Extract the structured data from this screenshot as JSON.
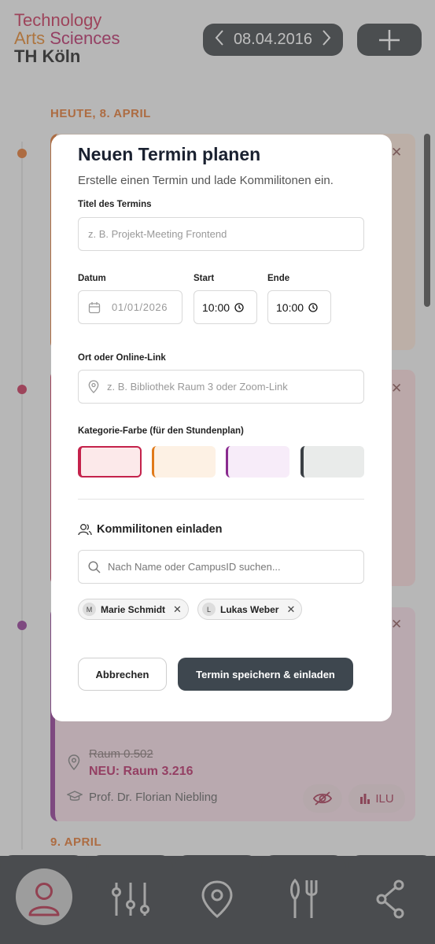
{
  "app": {
    "logo": {
      "line1": "Technology",
      "line2a": "Arts ",
      "line2b": "Sciences",
      "line3": "TH Köln"
    },
    "date": "08.04.2016",
    "day_heading_1": "HEUTE, 8. APRIL",
    "day_heading_2": "9. APRIL",
    "card3": {
      "old_room": "Raum 0.502",
      "new_room": "NEU: Raum 3.216",
      "lecturer": "Prof. Dr. Florian Niebling",
      "badge": "ILU"
    },
    "nav": [
      "profile-icon",
      "settings-sliders-icon",
      "location-pin-icon",
      "restaurant-icon",
      "share-icon"
    ]
  },
  "modal": {
    "title": "Neuen Termin planen",
    "subtitle": "Erstelle einen Termin und lade Kommilitonen ein.",
    "title_label": "Titel des Termins",
    "title_placeholder": "z. B. Projekt-Meeting Frontend",
    "date_label": "Datum",
    "date_value": "01/01/2026",
    "start_label": "Start",
    "start_value": "10:00",
    "end_label": "Ende",
    "end_value": "10:00",
    "location_label": "Ort oder Online-Link",
    "location_placeholder": "z. B. Bibliothek Raum 3 oder Zoom-Link",
    "category_label": "Kategorie-Farbe (für den Stundenplan)",
    "colors": [
      "#c4224b",
      "#e07a1a",
      "#8a2b8f",
      "#3a3f44"
    ],
    "invite_heading": "Kommilitonen einladen",
    "search_placeholder": "Nach Name oder CampusID suchen...",
    "invitees": [
      {
        "initial": "M",
        "name": "Marie Schmidt"
      },
      {
        "initial": "L",
        "name": "Lukas Weber"
      }
    ],
    "cancel_label": "Abbrechen",
    "save_label": "Termin speichern & einladen"
  }
}
